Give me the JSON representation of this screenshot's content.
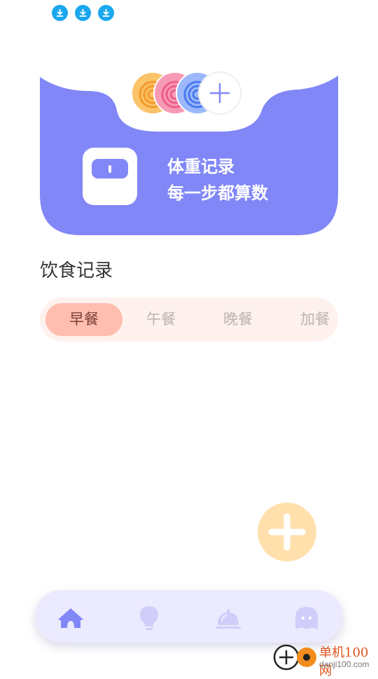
{
  "status_bar": {
    "icons": [
      "download-icon",
      "download-icon",
      "download-icon"
    ],
    "icon_color": "#1aa7ee"
  },
  "hero": {
    "line1": "体重记录",
    "line2": "每一步都算数",
    "bg_color": "#8187f7",
    "avatars": [
      "orange-fingerprint-avatar",
      "pink-fingerprint-avatar",
      "blue-fingerprint-avatar",
      "add-avatar-button"
    ]
  },
  "diet": {
    "title": "饮食记录",
    "tabs": [
      {
        "label": "早餐",
        "active": true
      },
      {
        "label": "午餐",
        "active": false
      },
      {
        "label": "晚餐",
        "active": false
      },
      {
        "label": "加餐",
        "active": false
      }
    ]
  },
  "fab": {
    "icon": "plus-icon",
    "color": "#ffe0ad"
  },
  "tabbar": {
    "items": [
      "home-icon",
      "lightbulb-icon",
      "service-bell-icon",
      "ghost-icon"
    ],
    "active_color": "#8187f7",
    "inactive_color": "#d1cdfb"
  },
  "watermark": {
    "name": "单机100网",
    "url": "danji100.com"
  }
}
